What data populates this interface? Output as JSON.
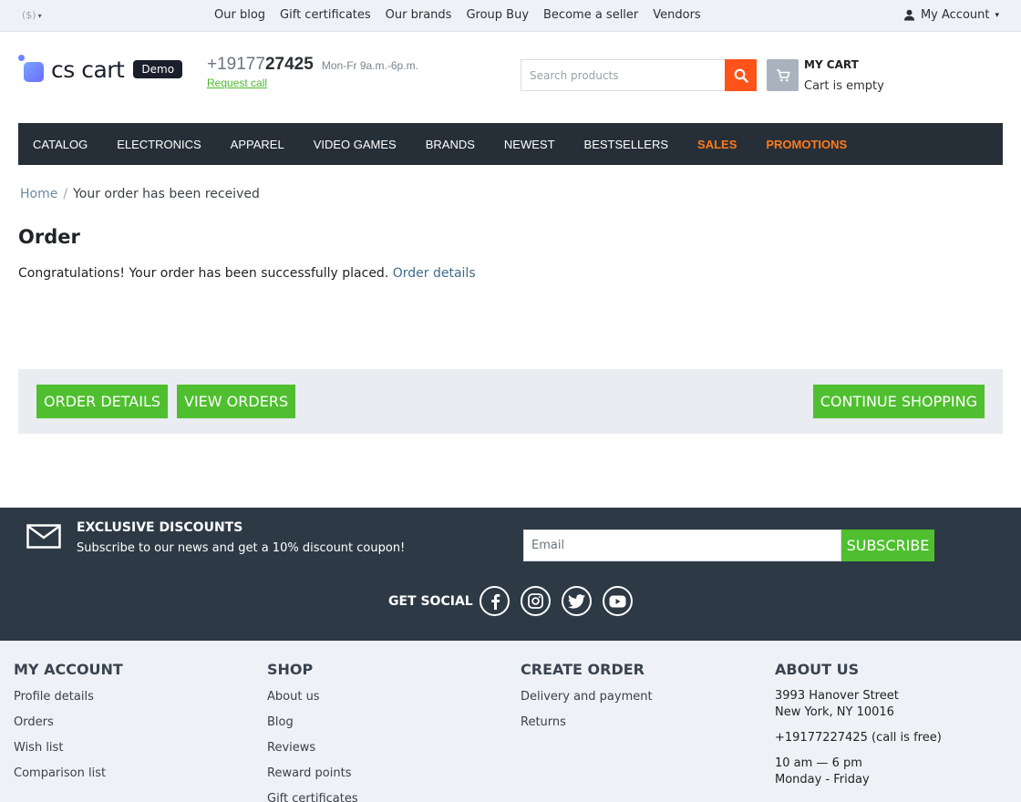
{
  "topbar": {
    "currency": "($)",
    "links": [
      "Our blog",
      "Gift certificates",
      "Our brands",
      "Group Buy",
      "Become a seller",
      "Vendors"
    ],
    "account": "My Account"
  },
  "header": {
    "logo_text": "cs cart",
    "demo_badge": "Demo",
    "phone_prefix": "+19177",
    "phone_suffix": "27425",
    "hours": "Mon-Fr 9a.m.-6p.m.",
    "request_call": "Request call",
    "search_placeholder": "Search products",
    "cart_title": "MY CART",
    "cart_status": "Cart is empty"
  },
  "nav": {
    "items": [
      "CATALOG",
      "ELECTRONICS",
      "APPAREL",
      "VIDEO GAMES",
      "BRANDS",
      "NEWEST",
      "BESTSELLERS",
      "SALES",
      "PROMOTIONS"
    ]
  },
  "breadcrumb": {
    "home": "Home",
    "separator": "/",
    "current": "Your order has been received"
  },
  "main": {
    "title": "Order",
    "message": "Congratulations! Your order has been successfully placed.",
    "message_link": "Order details",
    "buttons": {
      "order_details": "ORDER DETAILS",
      "view_orders": "VIEW ORDERS",
      "continue_shopping": "CONTINUE SHOPPING"
    }
  },
  "subscribe": {
    "title": "EXCLUSIVE DISCOUNTS",
    "description": "Subscribe to our news and get a 10% discount coupon!",
    "email_placeholder": "Email",
    "button": "SUBSCRIBE",
    "get_social": "GET SOCIAL",
    "icons": [
      "facebook-icon",
      "instagram-icon",
      "twitter-icon",
      "youtube-icon"
    ]
  },
  "footer": {
    "my_account": {
      "title": "MY ACCOUNT",
      "links": [
        "Profile details",
        "Orders",
        "Wish list",
        "Comparison list"
      ]
    },
    "shop": {
      "title": "SHOP",
      "links": [
        "About us",
        "Blog",
        "Reviews",
        "Reward points",
        "Gift certificates"
      ]
    },
    "create_order": {
      "title": "CREATE ORDER",
      "links": [
        "Delivery and payment",
        "Returns"
      ]
    },
    "about_us": {
      "title": "ABOUT US",
      "address_line1": "3993 Hanover Street",
      "address_line2": "New York, NY 10016",
      "phone": "+19177227425 (call is free)",
      "hours_line1": "10 am — 6 pm",
      "hours_line2": "Monday - Friday"
    }
  },
  "colors": {
    "accent_green": "#4fbf2f",
    "search_orange": "#ff5319",
    "nav_dark": "#262f38",
    "promo_orange": "#ff7a1a",
    "subscribe_bg": "#2d3a46"
  }
}
